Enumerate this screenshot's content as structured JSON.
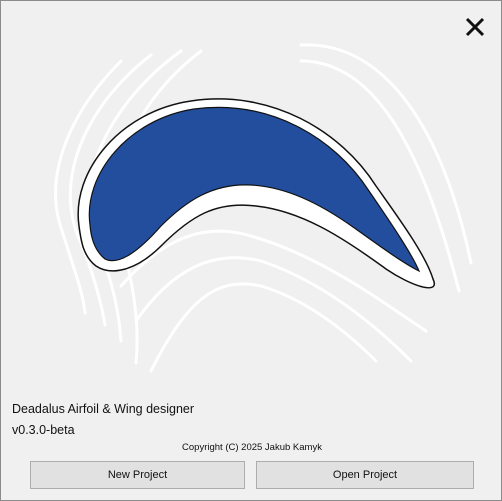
{
  "window": {
    "close_icon": "close-icon"
  },
  "splash": {
    "app_name": "Deadalus Airfoil & Wing designer",
    "version": "v0.3.0-beta",
    "copyright": "Copyright (C) 2025 Jakub Kamyk"
  },
  "buttons": {
    "new_project": "New Project",
    "open_project": "Open Project"
  },
  "colors": {
    "airfoil_fill": "#224e9d",
    "background": "#f0f0f0",
    "streamlines": "#ffffff"
  }
}
